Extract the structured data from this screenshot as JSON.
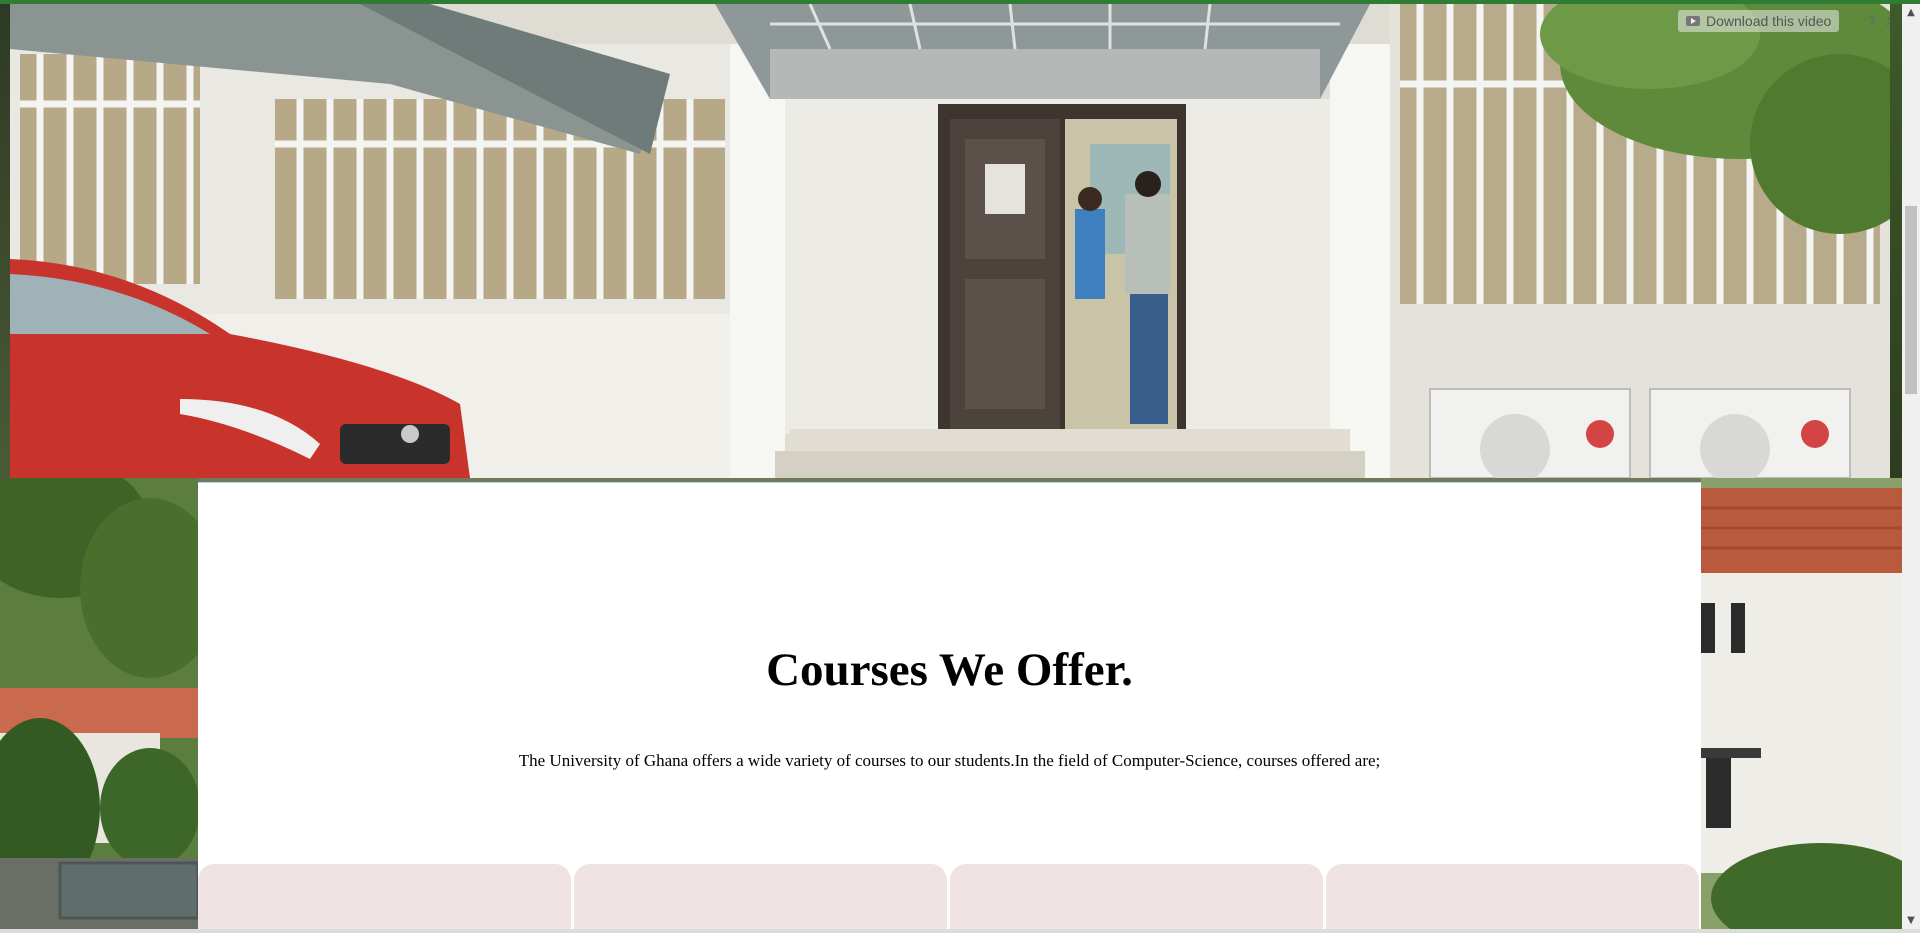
{
  "hero": {
    "download_label": "Download this video",
    "help_label": "?",
    "close_label": "X"
  },
  "courses_section": {
    "title": "Courses We Offer.",
    "description": "The University of Ghana offers a wide variety of courses to our students.In the field of Computer-Science, courses offered are;",
    "card_count_visible": 4
  },
  "scrollbar": {
    "up_glyph": "▲",
    "down_glyph": "▼"
  },
  "colors": {
    "card_background": "#efe3e3",
    "content_background": "#ffffff",
    "top_border": "#2e7d32"
  }
}
